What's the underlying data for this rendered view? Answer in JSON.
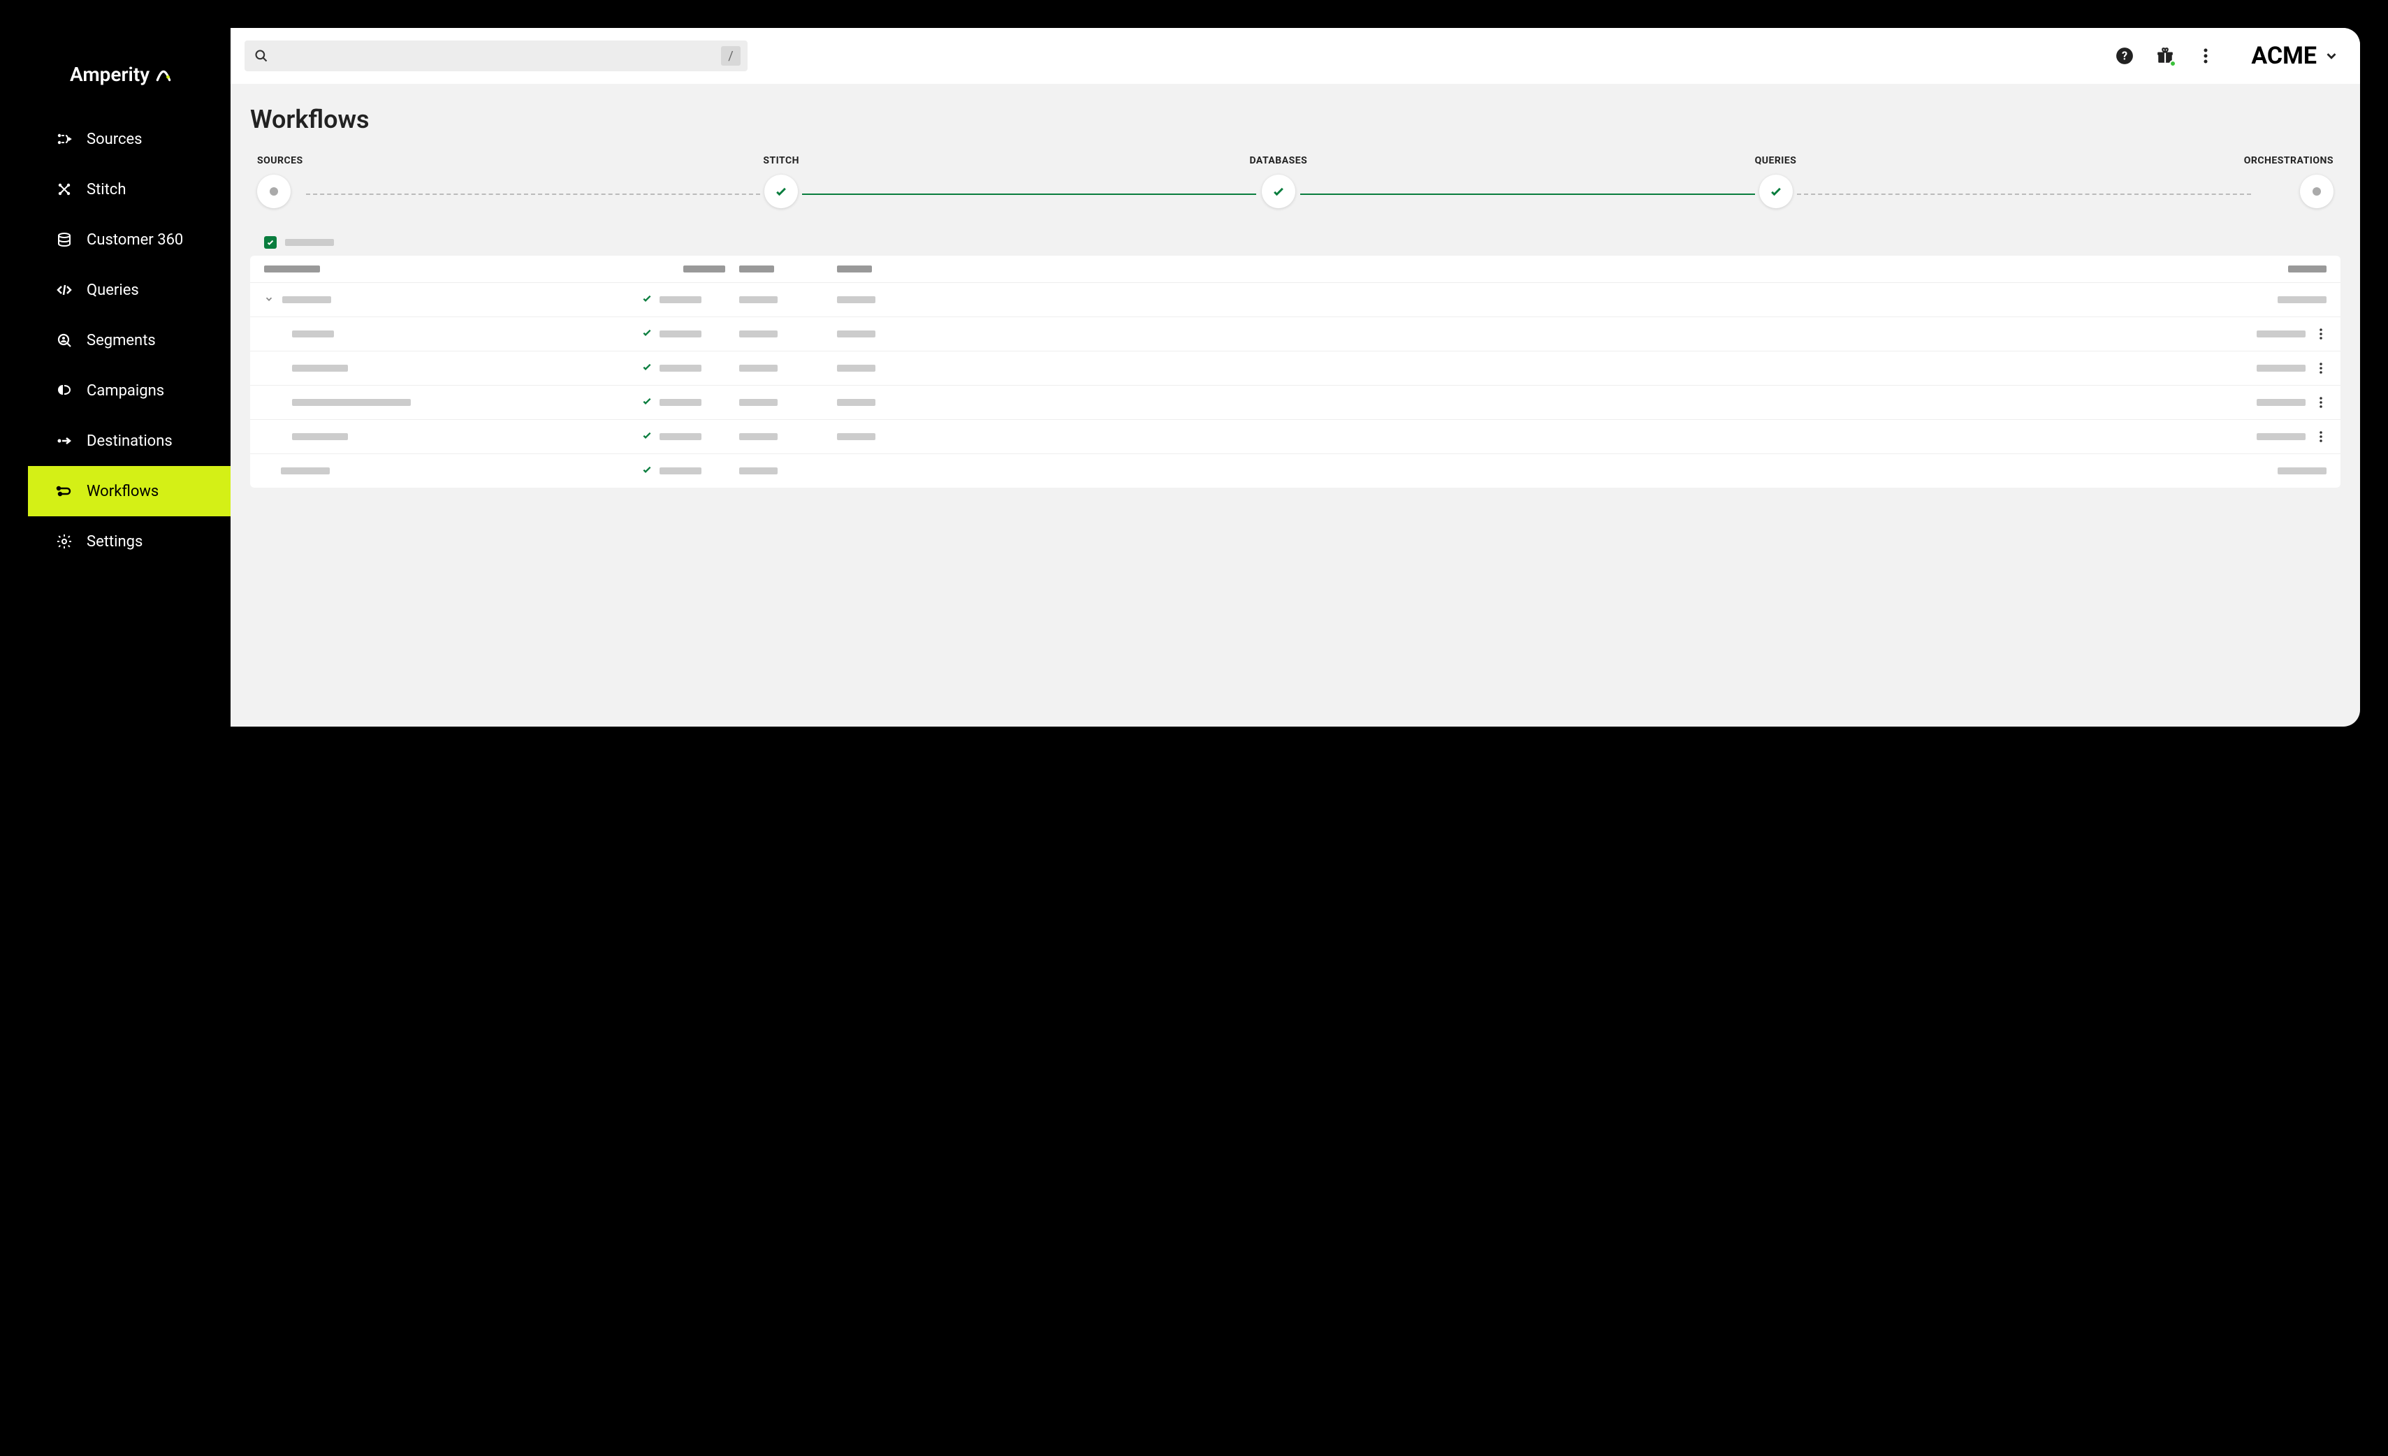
{
  "brand": {
    "name": "Amperity"
  },
  "sidebar": {
    "items": [
      {
        "label": "Sources",
        "icon": "sources"
      },
      {
        "label": "Stitch",
        "icon": "stitch"
      },
      {
        "label": "Customer 360",
        "icon": "customer360"
      },
      {
        "label": "Queries",
        "icon": "queries"
      },
      {
        "label": "Segments",
        "icon": "segments"
      },
      {
        "label": "Campaigns",
        "icon": "campaigns"
      },
      {
        "label": "Destinations",
        "icon": "destinations"
      },
      {
        "label": "Workflows",
        "icon": "workflows",
        "active": true
      },
      {
        "label": "Settings",
        "icon": "settings"
      }
    ]
  },
  "header": {
    "search_placeholder": "",
    "shortcut_hint": "/",
    "tenant": "ACME"
  },
  "page": {
    "title": "Workflows"
  },
  "pipeline": {
    "steps": [
      {
        "label": "SOURCES",
        "state": "idle"
      },
      {
        "label": "STITCH",
        "state": "done"
      },
      {
        "label": "DATABASES",
        "state": "done"
      },
      {
        "label": "QUERIES",
        "state": "done"
      },
      {
        "label": "ORCHESTRATIONS",
        "state": "idle"
      }
    ],
    "connectors": [
      "dashed",
      "solid",
      "solid",
      "solid",
      "dashed"
    ]
  },
  "table": {
    "filter_checked": true,
    "columns": [
      "name",
      "status",
      "col_a",
      "col_b",
      "col_end"
    ],
    "rows": [
      {
        "type": "header"
      },
      {
        "type": "group",
        "indent": 0,
        "status_check": true,
        "has_menu": false,
        "cols": 4
      },
      {
        "type": "item",
        "indent": 1,
        "status_check": true,
        "has_menu": true,
        "cols": 4
      },
      {
        "type": "item",
        "indent": 1,
        "status_check": true,
        "has_menu": true,
        "cols": 4
      },
      {
        "type": "item",
        "indent": 1,
        "status_check": true,
        "has_menu": true,
        "cols": 4
      },
      {
        "type": "item",
        "indent": 1,
        "status_check": true,
        "has_menu": true,
        "cols": 4
      },
      {
        "type": "item",
        "indent": 0,
        "status_check": true,
        "has_menu": false,
        "cols": 3
      }
    ]
  }
}
